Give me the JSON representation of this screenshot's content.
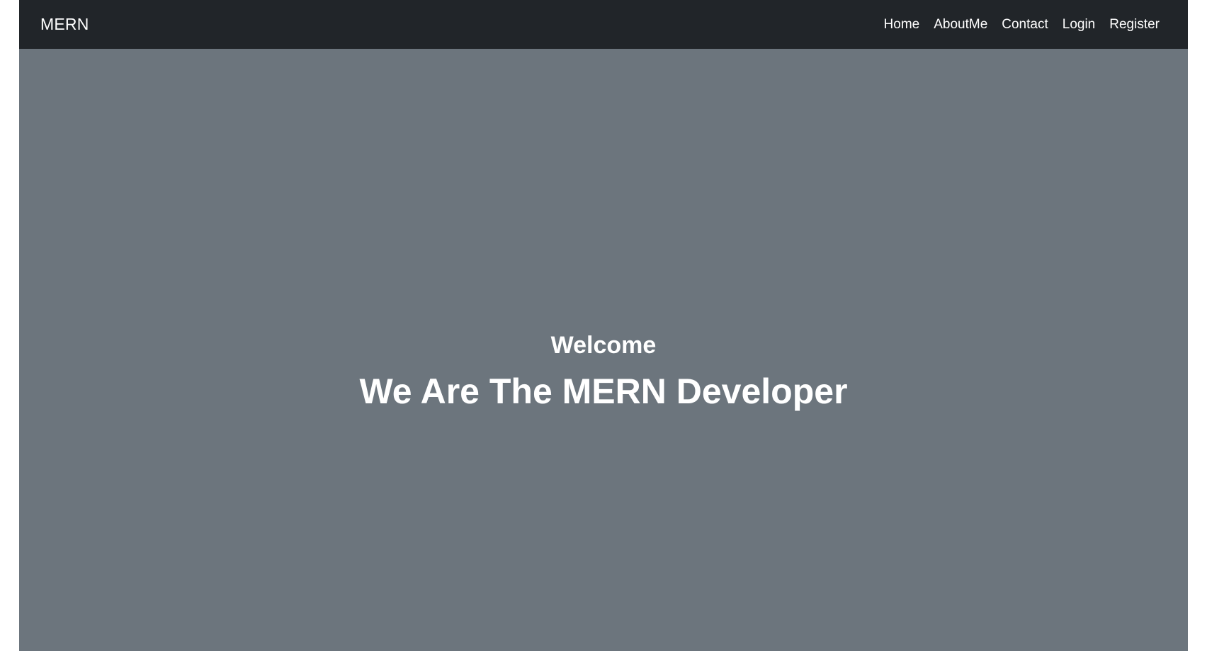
{
  "navbar": {
    "brand": "MERN",
    "links": [
      {
        "label": "Home"
      },
      {
        "label": "AboutMe"
      },
      {
        "label": "Contact"
      },
      {
        "label": "Login"
      },
      {
        "label": "Register"
      }
    ]
  },
  "hero": {
    "welcome": "Welcome",
    "title": "We Are The MERN Developer"
  },
  "colors": {
    "navbar_bg": "#212529",
    "hero_bg": "#6c757d",
    "text": "#ffffff"
  }
}
